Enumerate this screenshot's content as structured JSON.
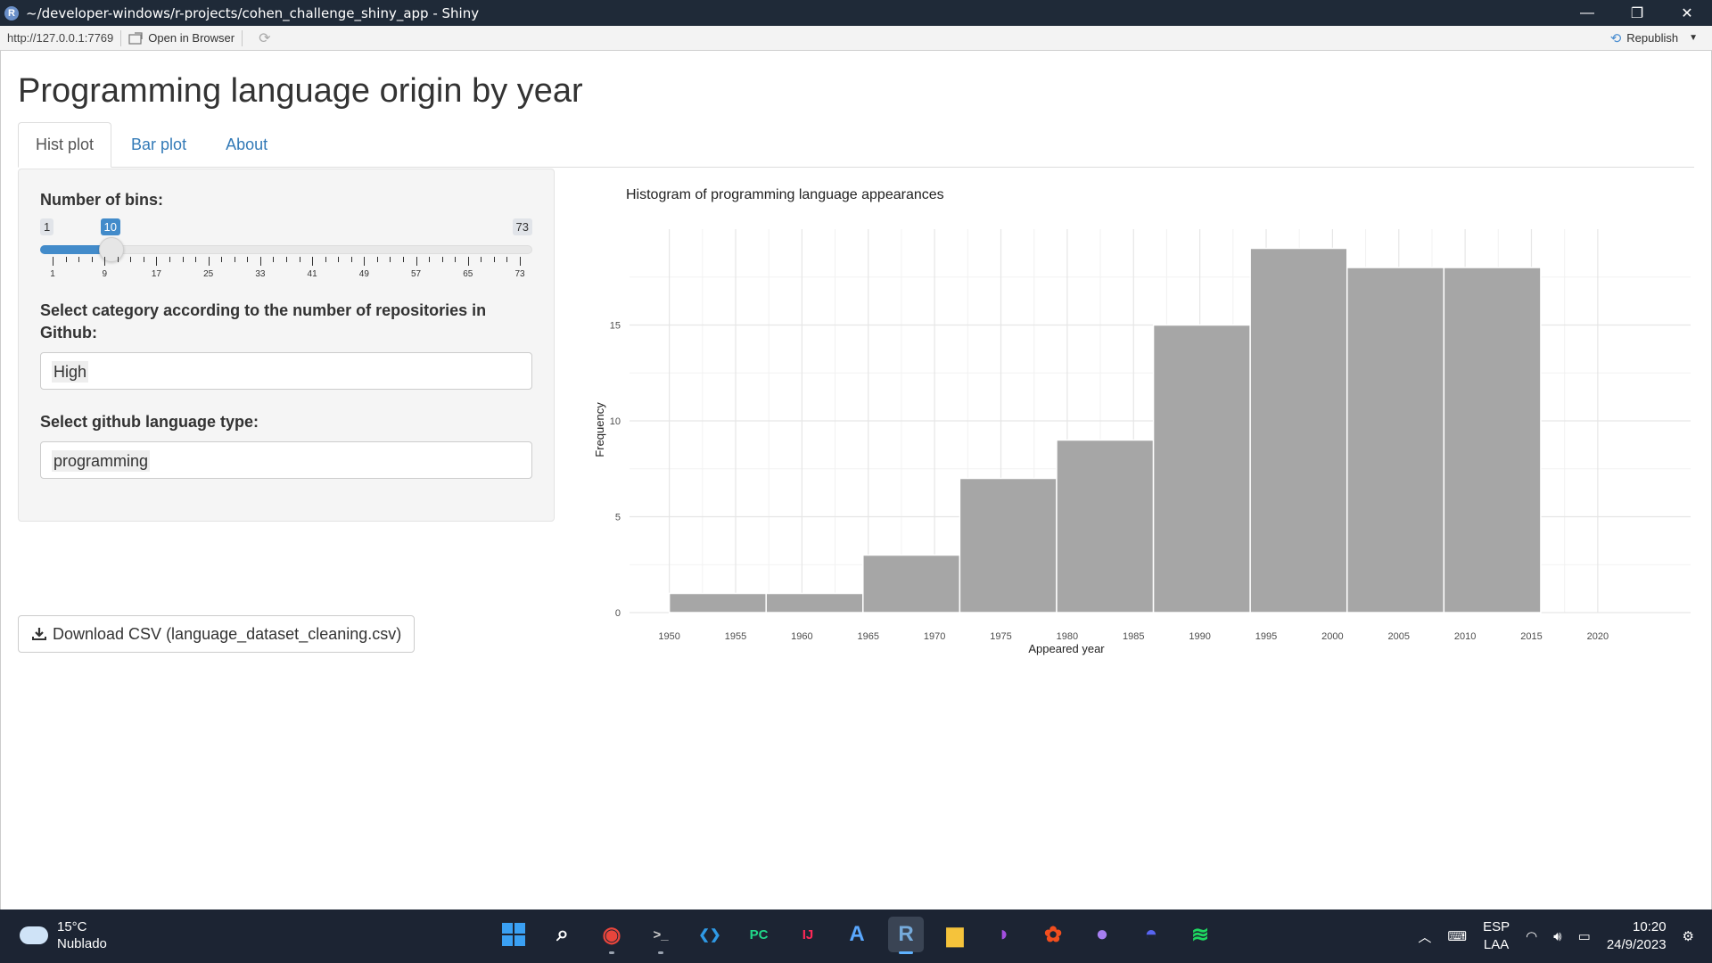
{
  "window": {
    "title": "~/developer-windows/r-projects/cohen_challenge_shiny_app - Shiny",
    "app_icon": "R",
    "minimize": "—",
    "restore": "❐",
    "close": "✕"
  },
  "addressbar": {
    "url": "http://127.0.0.1:7769",
    "open_in_browser": "Open in Browser",
    "republish": "Republish"
  },
  "page": {
    "title": "Programming language origin by year",
    "tabs": [
      {
        "label": "Hist plot",
        "active": true
      },
      {
        "label": "Bar plot",
        "active": false
      },
      {
        "label": "About",
        "active": false
      }
    ]
  },
  "sidebar": {
    "bins_label": "Number of bins:",
    "bins_min": "1",
    "bins_value": "10",
    "bins_max": "73",
    "bins_fraction": 0.125,
    "ticks": [
      "1",
      "9",
      "17",
      "25",
      "33",
      "41",
      "49",
      "57",
      "65",
      "73"
    ],
    "category_label": "Select category according to the number of repositories in Github:",
    "category_value": "High",
    "type_label": "Select github language type:",
    "type_value": "programming"
  },
  "download": {
    "label": "Download CSV (language_dataset_cleaning.csv)"
  },
  "chart_data": {
    "type": "bar",
    "title": "Histogram of programming language appearances",
    "xlabel": "Appeared year",
    "ylabel": "Frequency",
    "bins": [
      {
        "x0": 1950,
        "x1": 1957.3,
        "count": 1
      },
      {
        "x0": 1957.3,
        "x1": 1964.6,
        "count": 1
      },
      {
        "x0": 1964.6,
        "x1": 1971.9,
        "count": 3
      },
      {
        "x0": 1971.9,
        "x1": 1979.2,
        "count": 7
      },
      {
        "x0": 1979.2,
        "x1": 1986.5,
        "count": 9
      },
      {
        "x0": 1986.5,
        "x1": 1993.8,
        "count": 15
      },
      {
        "x0": 1993.8,
        "x1": 2001.1,
        "count": 19
      },
      {
        "x0": 2001.1,
        "x1": 2008.4,
        "count": 18
      },
      {
        "x0": 2008.4,
        "x1": 2015.7,
        "count": 18
      }
    ],
    "xlim": [
      1947,
      2027
    ],
    "ylim": [
      0,
      20
    ],
    "xticks": [
      1950,
      1955,
      1960,
      1965,
      1970,
      1975,
      1980,
      1985,
      1990,
      1995,
      2000,
      2005,
      2010,
      2015,
      2020
    ],
    "yticks": [
      0,
      5,
      10,
      15
    ],
    "bar_color": "#a6a6a6",
    "grid": true
  },
  "taskbar": {
    "temperature": "15°C",
    "weather": "Nublado",
    "apps": [
      {
        "name": "windows-start-icon",
        "glyph": "",
        "color": "#3aa0f3"
      },
      {
        "name": "search-icon",
        "glyph": "⌕",
        "color": "#ffffff"
      },
      {
        "name": "chrome-icon",
        "glyph": "◉",
        "color": "#e8453c"
      },
      {
        "name": "terminal-icon",
        "glyph": ">_",
        "color": "#cccccc"
      },
      {
        "name": "vscode-icon",
        "glyph": "❮❯",
        "color": "#2f9ae6"
      },
      {
        "name": "pycharm-icon",
        "glyph": "PC",
        "color": "#21d789"
      },
      {
        "name": "intellij-icon",
        "glyph": "IJ",
        "color": "#fe2857"
      },
      {
        "name": "app-store-icon",
        "glyph": "A",
        "color": "#5aa8ff"
      },
      {
        "name": "rstudio-icon",
        "glyph": "R",
        "color": "#75aadb"
      },
      {
        "name": "file-explorer-icon",
        "glyph": "▆",
        "color": "#f5c33b"
      },
      {
        "name": "podcast-icon",
        "glyph": "◗",
        "color": "#a34fe0"
      },
      {
        "name": "figma-icon",
        "glyph": "✿",
        "color": "#f24e1e"
      },
      {
        "name": "github-icon",
        "glyph": "●",
        "color": "#a77ff2"
      },
      {
        "name": "discord-icon",
        "glyph": "◓",
        "color": "#5865f2"
      },
      {
        "name": "spotify-icon",
        "glyph": "≋",
        "color": "#1ed760"
      }
    ],
    "active_app": 8,
    "lang_line1": "ESP",
    "lang_line2": "LAA",
    "time": "10:20",
    "date": "24/9/2023"
  }
}
